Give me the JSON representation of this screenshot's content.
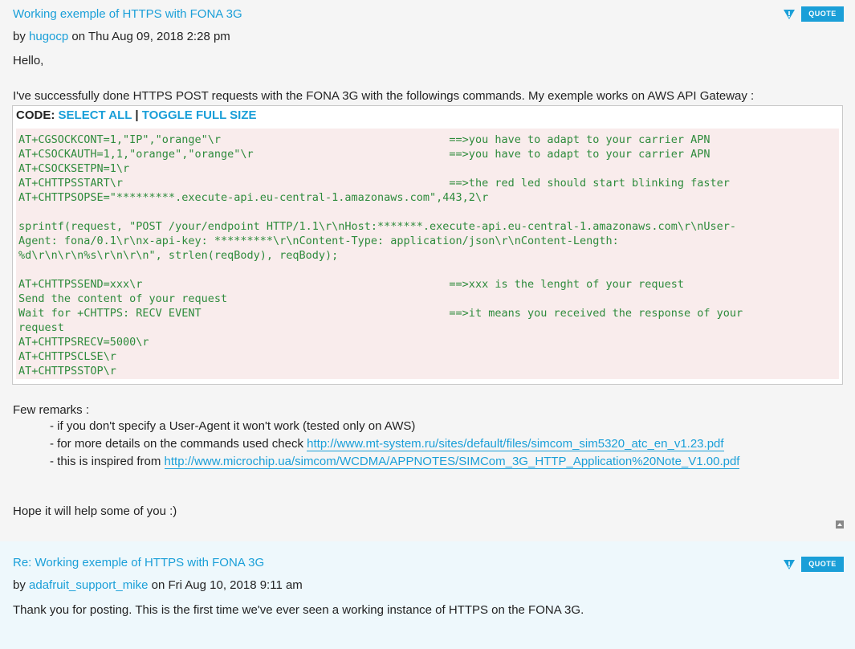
{
  "post1": {
    "title": "Working exemple of HTTPS with FONA 3G",
    "by": "by",
    "author": "hugocp",
    "date": "on Thu Aug 09, 2018 2:28 pm",
    "report_icon": "report-icon",
    "quote_label": "QUOTE",
    "greeting": "Hello,",
    "intro": "I've successfully done HTTPS POST requests with the FONA 3G with the followings commands. My exemple works on AWS API Gateway :",
    "code": {
      "label": "CODE:",
      "select_all": "SELECT ALL",
      "separator": "|",
      "toggle": "TOGGLE FULL SIZE",
      "content": "AT+CGSOCKCONT=1,\"IP\",\"orange\"\\r                                   ==>you have to adapt to your carrier APN\nAT+CSOCKAUTH=1,1,\"orange\",\"orange\"\\r                              ==>you have to adapt to your carrier APN\nAT+CSOCKSETPN=1\\r\nAT+CHTTPSSTART\\r                                                  ==>the red led should start blinking faster\nAT+CHTTPSOPSE=\"*********.execute-api.eu-central-1.amazonaws.com\",443,2\\r\n\nsprintf(request, \"POST /your/endpoint HTTP/1.1\\r\\nHost:*******.execute-api.eu-central-1.amazonaws.com\\r\\nUser-\nAgent: fona/0.1\\r\\nx-api-key: *********\\r\\nContent-Type: application/json\\r\\nContent-Length:\n%d\\r\\n\\r\\n%s\\r\\n\\r\\n\", strlen(reqBody), reqBody);\n\nAT+CHTTPSSEND=xxx\\r                                               ==>xxx is the lenght of your request\nSend the content of your request\nWait for +CHTTPS: RECV EVENT                                      ==>it means you received the response of your\nrequest\nAT+CHTTPSRECV=5000\\r\nAT+CHTTPSCLSE\\r\nAT+CHTTPSSTOP\\r"
    },
    "remarks_title": "Few remarks :",
    "remarks": [
      {
        "text": "- if you don't specify a User-Agent it won't work (tested only on AWS)",
        "link": ""
      },
      {
        "text": "- for more details on the commands used check ",
        "link": "http://www.mt-system.ru/sites/default/files/simcom_sim5320_atc_en_v1.23.pdf"
      },
      {
        "text": "- this is inspired from ",
        "link": "http://www.microchip.ua/simcom/WCDMA/APPNOTES/SIMCom_3G_HTTP_Application%20Note_V1.00.pdf"
      }
    ],
    "closing": "Hope it will help some of you :)"
  },
  "post2": {
    "title": "Re: Working exemple of HTTPS with FONA 3G",
    "by": "by",
    "author": "adafruit_support_mike",
    "date": "on Fri Aug 10, 2018 9:11 am",
    "quote_label": "QUOTE",
    "body": "Thank you for posting. This is the first time we've ever seen a working instance of HTTPS on the FONA 3G."
  },
  "colors": {
    "accent": "#1a9fd8",
    "code_text": "#2e8b3c",
    "code_bg": "#f9ecec",
    "post2_bg": "#eef8fc"
  }
}
